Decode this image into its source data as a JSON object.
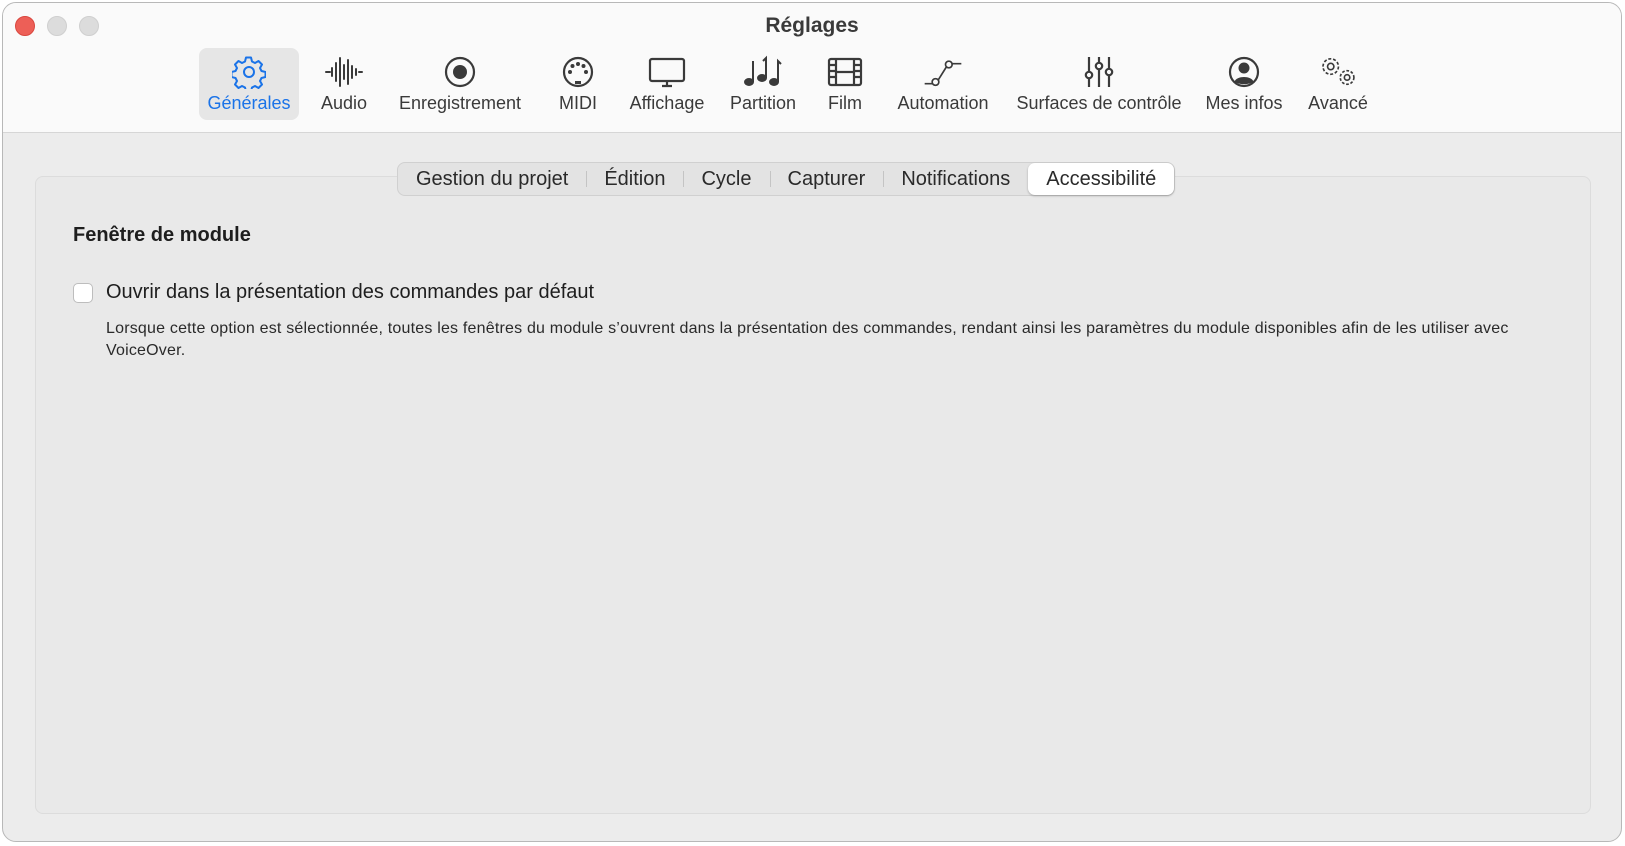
{
  "window": {
    "title": "Réglages"
  },
  "toolbar": {
    "items": [
      {
        "label": "Générales",
        "icon": "gear-icon",
        "active": true
      },
      {
        "label": "Audio",
        "icon": "waveform-icon"
      },
      {
        "label": "Enregistrement",
        "icon": "record-icon"
      },
      {
        "label": "MIDI",
        "icon": "midi-connector-icon"
      },
      {
        "label": "Affichage",
        "icon": "display-icon"
      },
      {
        "label": "Partition",
        "icon": "music-notes-icon"
      },
      {
        "label": "Film",
        "icon": "film-icon"
      },
      {
        "label": "Automation",
        "icon": "automation-curve-icon"
      },
      {
        "label": "Surfaces de contrôle",
        "icon": "sliders-icon"
      },
      {
        "label": "Mes infos",
        "icon": "person-circle-icon"
      },
      {
        "label": "Avancé",
        "icon": "gears-icon"
      }
    ]
  },
  "tabs": [
    {
      "label": "Gestion du projet"
    },
    {
      "label": "Édition"
    },
    {
      "label": "Cycle"
    },
    {
      "label": "Capturer"
    },
    {
      "label": "Notifications"
    },
    {
      "label": "Accessibilité",
      "selected": true
    }
  ],
  "content": {
    "section_title": "Fenêtre de module",
    "option_label": "Ouvrir dans la présentation des commandes par défaut",
    "option_checked": false,
    "description": "Lorsque cette option est sélectionnée, toutes les fenêtres du module s’ouvrent dans la présentation des commandes, rendant ainsi les paramètres du module disponibles afin de les utiliser avec VoiceOver."
  },
  "colors": {
    "accent": "#1a73e8",
    "close": "#ed5f57"
  }
}
